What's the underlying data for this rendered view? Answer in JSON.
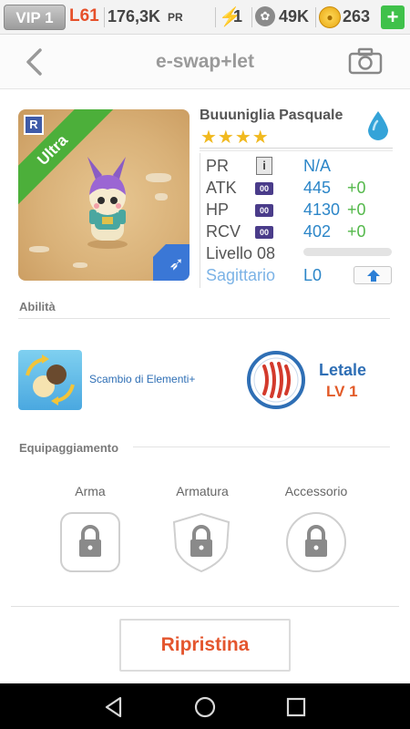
{
  "status": {
    "vip": "VIP 1",
    "level": "L61",
    "pr_value": "176,3K",
    "pr_label": "PR",
    "energy": "1",
    "paws": "49K",
    "coins": "263",
    "plus": "+"
  },
  "header": {
    "title": "e-swap+let"
  },
  "monster": {
    "name": "Buuuniglia Pasquale",
    "stars": "★★★★",
    "rarity": "Ultra",
    "r_badge": "R"
  },
  "stats": {
    "pr": {
      "label": "PR",
      "value": "N/A"
    },
    "atk": {
      "label": "ATK",
      "value": "445",
      "bonus": "+0",
      "badge": "00"
    },
    "hp": {
      "label": "HP",
      "value": "4130",
      "bonus": "+0",
      "badge": "00"
    },
    "rcv": {
      "label": "RCV",
      "value": "402",
      "bonus": "+0",
      "badge": "00"
    },
    "level": {
      "label": "Livello 08",
      "progress": 0
    },
    "zodiac": {
      "label": "Sagittario",
      "value": "L0"
    }
  },
  "abilities": {
    "section": "Abilità",
    "skill_name": "Scambio di Elementi+",
    "passive_name": "Letale",
    "passive_level": "LV 1"
  },
  "equipment": {
    "section": "Equipaggiamento",
    "weapon": "Arma",
    "armor": "Armatura",
    "accessory": "Accessorio"
  },
  "actions": {
    "reset": "Ripristina"
  },
  "colors": {
    "accent_blue": "#2c86c8",
    "bonus_green": "#53b84a",
    "action_red": "#e4562e",
    "ultra_green": "#4caf3a"
  }
}
